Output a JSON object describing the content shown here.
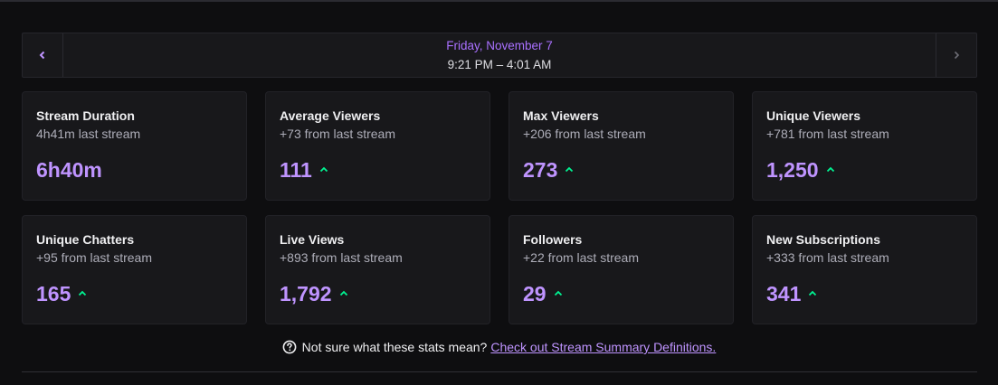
{
  "header": {
    "date_label": "Friday, November 7",
    "time_range": "9:21 PM – 4:01 AM",
    "prev_icon": "chevron-left-icon",
    "next_icon": "chevron-right-icon"
  },
  "colors": {
    "accent": "#a970ff",
    "value": "#bf94ff",
    "trend_up": "#00f593",
    "card_bg": "#18181b",
    "page_bg": "#0e0e10"
  },
  "stats": [
    {
      "title": "Stream Duration",
      "comparison": "4h41m last stream",
      "value": "6h40m",
      "trend": "none"
    },
    {
      "title": "Average Viewers",
      "comparison": "+73 from last stream",
      "value": "111",
      "trend": "up"
    },
    {
      "title": "Max Viewers",
      "comparison": "+206 from last stream",
      "value": "273",
      "trend": "up"
    },
    {
      "title": "Unique Viewers",
      "comparison": "+781 from last stream",
      "value": "1,250",
      "trend": "up"
    },
    {
      "title": "Unique Chatters",
      "comparison": "+95 from last stream",
      "value": "165",
      "trend": "up"
    },
    {
      "title": "Live Views",
      "comparison": "+893 from last stream",
      "value": "1,792",
      "trend": "up"
    },
    {
      "title": "Followers",
      "comparison": "+22 from last stream",
      "value": "29",
      "trend": "up"
    },
    {
      "title": "New Subscriptions",
      "comparison": "+333 from last stream",
      "value": "341",
      "trend": "up"
    }
  ],
  "footer": {
    "question": "Not sure what these stats mean?",
    "link_text": "Check out Stream Summary Definitions.",
    "help_icon": "question-circle-icon"
  }
}
